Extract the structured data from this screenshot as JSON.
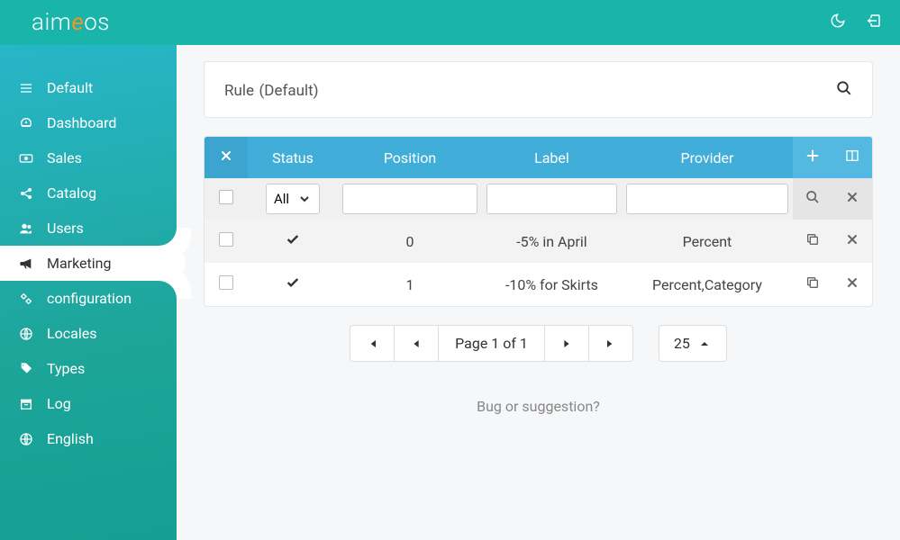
{
  "header": {
    "logo_pre": "aim",
    "logo_e": "e",
    "logo_post": "os"
  },
  "sidebar": {
    "items": [
      {
        "label": "Default"
      },
      {
        "label": "Dashboard"
      },
      {
        "label": "Sales"
      },
      {
        "label": "Catalog"
      },
      {
        "label": "Users"
      },
      {
        "label": "Marketing"
      },
      {
        "label": "configuration"
      },
      {
        "label": "Locales"
      },
      {
        "label": "Types"
      },
      {
        "label": "Log"
      },
      {
        "label": "English"
      }
    ]
  },
  "page": {
    "title": "Rule",
    "subtitle": "(Default)"
  },
  "table": {
    "headers": {
      "status": "Status",
      "position": "Position",
      "label": "Label",
      "provider": "Provider"
    },
    "filter": {
      "status_all": "All"
    },
    "rows": [
      {
        "position": "0",
        "label": "-5% in April",
        "provider": "Percent"
      },
      {
        "position": "1",
        "label": "-10% for Skirts",
        "provider": "Percent,Category"
      }
    ]
  },
  "pagination": {
    "info": "Page 1 of 1",
    "size": "25"
  },
  "footer": {
    "text": "Bug or suggestion?"
  }
}
